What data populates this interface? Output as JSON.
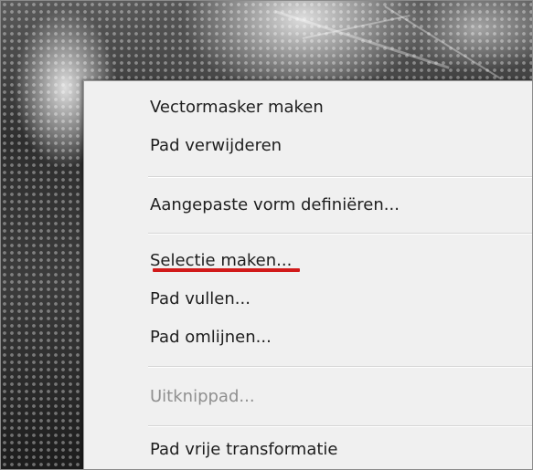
{
  "context_menu": {
    "items": [
      {
        "label": "Vectormasker maken",
        "enabled": true
      },
      {
        "label": "Pad verwijderen",
        "enabled": true
      },
      {
        "label": "Aangepaste vorm definiëren...",
        "enabled": true
      },
      {
        "label": "Selectie maken...",
        "enabled": true,
        "highlighted_annotation": true
      },
      {
        "label": "Pad vullen...",
        "enabled": true
      },
      {
        "label": "Pad omlijnen...",
        "enabled": true
      },
      {
        "label": "Uitknippad...",
        "enabled": false
      },
      {
        "label": "Pad vrije transformatie",
        "enabled": true
      }
    ],
    "annotation_color": "#d11a1a",
    "disabled_text_color": "#8f8f8f"
  }
}
